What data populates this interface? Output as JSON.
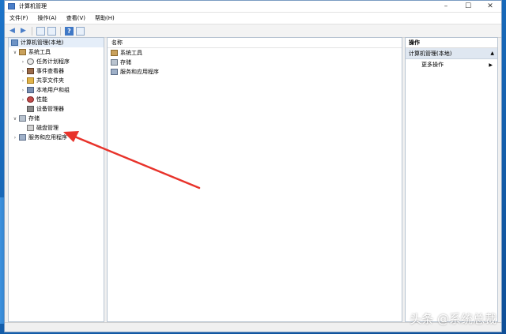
{
  "window": {
    "title": "计算机管理",
    "controls": [
      "minimize-icon",
      "maximize-icon",
      "close-icon"
    ]
  },
  "menu": [
    "文件(F)",
    "操作(A)",
    "查看(V)",
    "帮助(H)"
  ],
  "toolbar": {
    "icons": [
      "back-arrow-icon",
      "forward-arrow-icon",
      "show-tree-icon",
      "export-list-icon",
      "help-icon",
      "properties-icon"
    ]
  },
  "tree": {
    "root": "计算机管理(本地)",
    "system_tools": {
      "label": "系统工具",
      "children": [
        "任务计划程序",
        "事件查看器",
        "共享文件夹",
        "本地用户和组",
        "性能",
        "设备管理器"
      ]
    },
    "storage": {
      "label": "存储",
      "children": [
        "磁盘管理"
      ]
    },
    "services": "服务和应用程序"
  },
  "list": {
    "column_header": "名称",
    "items": [
      "系统工具",
      "存储",
      "服务和应用程序"
    ]
  },
  "actions": {
    "header": "操作",
    "section": "计算机管理(本地)",
    "items": [
      "更多操作"
    ]
  },
  "watermark": "头条 @系统总裁",
  "colors": {
    "desktop": "#1766b5",
    "arrow": "#e8332b",
    "selection": "#dfe7f1"
  }
}
